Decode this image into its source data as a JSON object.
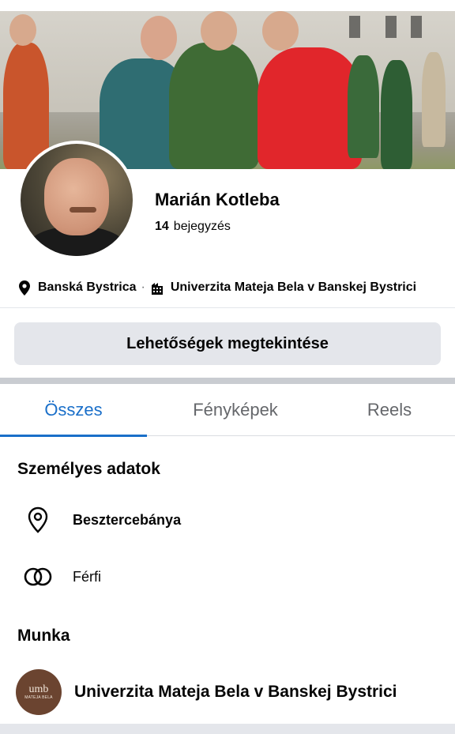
{
  "profile": {
    "name": "Marián Kotleba",
    "post_count": "14",
    "post_label": "bejegyzés"
  },
  "meta": {
    "location": "Banská Bystrica",
    "separator": "·",
    "workplace": "Univerzita Mateja Bela v Banskej Bystrici"
  },
  "actions": {
    "options_label": "Lehetőségek megtekintése"
  },
  "tabs": [
    {
      "label": "Összes",
      "active": true
    },
    {
      "label": "Fényképek",
      "active": false
    },
    {
      "label": "Reels",
      "active": false
    }
  ],
  "personal": {
    "title": "Személyes adatok",
    "city": "Besztercebánya",
    "gender": "Férfi"
  },
  "work": {
    "title": "Munka",
    "employer": "Univerzita Mateja Bela v Banskej Bystrici",
    "logo_text": "umb",
    "logo_subtext": "MATEJA BELA"
  },
  "icons": {
    "location": "map-pin-icon",
    "workplace": "building-icon",
    "gender": "interlocking-rings-icon",
    "logo": "umb-logo-icon"
  },
  "colors": {
    "accent": "#1a6fc9",
    "button_bg": "#e4e6eb",
    "secondary_text": "#65676b",
    "logo_bg": "#6b4430"
  }
}
